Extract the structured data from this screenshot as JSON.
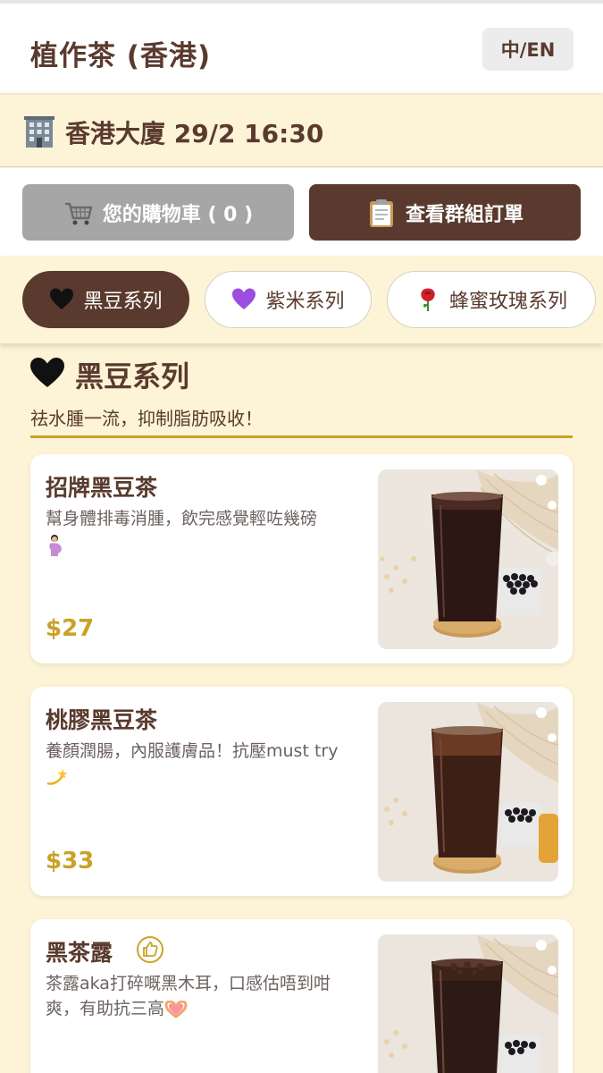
{
  "header": {
    "shop_title": "植作茶 (香港)",
    "lang_toggle": "中/EN"
  },
  "info": {
    "text": "香港大廈 29/2 16:30",
    "icon": "building-icon"
  },
  "actions": {
    "cart": {
      "label": "您的購物車 ( 0 )",
      "icon": "cart-icon"
    },
    "group_orders": {
      "label": "查看群組訂單",
      "icon": "clipboard-icon"
    }
  },
  "tabs": [
    {
      "label": "黑豆系列",
      "icon": "black-heart-icon",
      "active": true
    },
    {
      "label": "紫米系列",
      "icon": "purple-heart-icon",
      "active": false
    },
    {
      "label": "蜂蜜玫瑰系列",
      "icon": "rose-icon",
      "active": false
    }
  ],
  "section": {
    "title": "黑豆系列",
    "description": "祛水腫一流，抑制脂肪吸收！",
    "icon": "black-heart-icon"
  },
  "products": [
    {
      "name": "招牌黑豆茶",
      "description": "幫身體排毒消腫，飲完感覺輕咗幾磅",
      "price": "$27"
    },
    {
      "name": "桃膠黑豆茶",
      "description": "養顏潤腸，內服護膚品！抗壓must try",
      "price": "$33"
    },
    {
      "name": "黑茶露",
      "description": "茶露aka打碎嘅黑木耳，口感估唔到咁爽，有助抗三高",
      "price": "",
      "badge_icon": "thumbs-up-icon"
    }
  ],
  "colors": {
    "brand_brown": "#5a3a2e",
    "price_gold": "#c9a227",
    "cream_bg": "#fdf3d6",
    "disabled_gray": "#a6a6a6"
  }
}
